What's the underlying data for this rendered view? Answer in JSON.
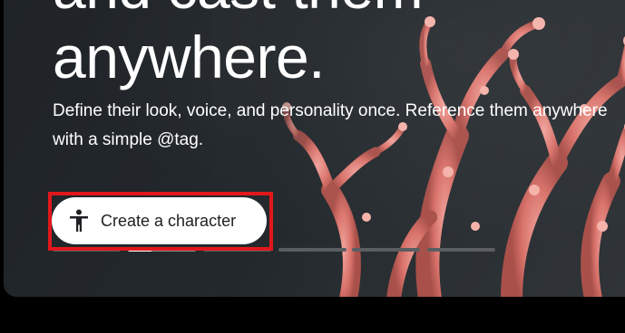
{
  "hero": {
    "headline_line1": "and cast them",
    "headline_line2": "anywhere.",
    "description": "Define their look, voice, and personality once. Reference them anywhere with a simple @tag.",
    "cta_label": "Create a character",
    "cta_icon": "accessibility-person-icon",
    "background_art": "pink-coral"
  },
  "carousel": {
    "slides": 6,
    "active_index": 1,
    "active_progress": 0.35
  },
  "colors": {
    "card_background": "#23282c",
    "headline_text": "#ffffff",
    "button_background": "#ffffff",
    "button_text": "#202124",
    "highlight_border": "#e0181b",
    "coral": "#e07a72"
  }
}
